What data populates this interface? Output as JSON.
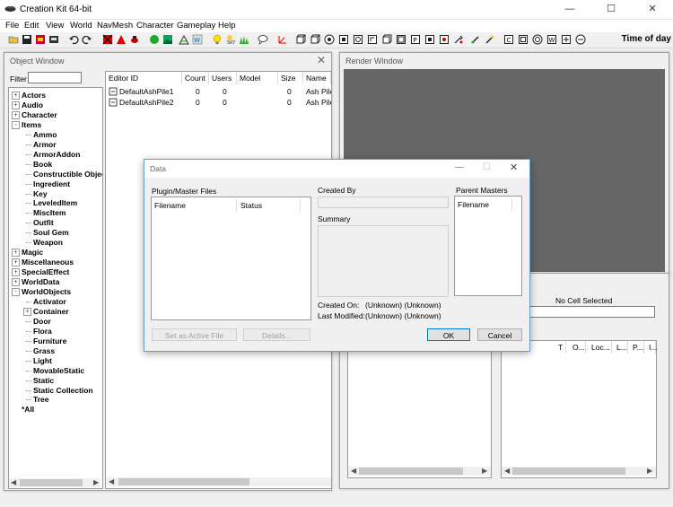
{
  "app": {
    "title": "Creation Kit 64-bit"
  },
  "menu": [
    "File",
    "Edit",
    "View",
    "World",
    "NavMesh",
    "Character",
    "Gameplay",
    "Help"
  ],
  "toolbar": {
    "time_of_day_label": "Time of day"
  },
  "object_window": {
    "title": "Object Window",
    "filter_label": "Filter",
    "filter_value": "",
    "tree": [
      {
        "label": "Actors",
        "level": 0,
        "expander": "+"
      },
      {
        "label": "Audio",
        "level": 0,
        "expander": "+"
      },
      {
        "label": "Character",
        "level": 0,
        "expander": "+"
      },
      {
        "label": "Items",
        "level": 0,
        "expander": "-"
      },
      {
        "label": "Ammo",
        "level": 1
      },
      {
        "label": "Armor",
        "level": 1
      },
      {
        "label": "ArmorAddon",
        "level": 1
      },
      {
        "label": "Book",
        "level": 1
      },
      {
        "label": "Constructible Objec",
        "level": 1
      },
      {
        "label": "Ingredient",
        "level": 1
      },
      {
        "label": "Key",
        "level": 1
      },
      {
        "label": "LeveledItem",
        "level": 1
      },
      {
        "label": "MiscItem",
        "level": 1
      },
      {
        "label": "Outfit",
        "level": 1
      },
      {
        "label": "Soul Gem",
        "level": 1
      },
      {
        "label": "Weapon",
        "level": 1
      },
      {
        "label": "Magic",
        "level": 0,
        "expander": "+"
      },
      {
        "label": "Miscellaneous",
        "level": 0,
        "expander": "+"
      },
      {
        "label": "SpecialEffect",
        "level": 0,
        "expander": "+"
      },
      {
        "label": "WorldData",
        "level": 0,
        "expander": "+"
      },
      {
        "label": "WorldObjects",
        "level": 0,
        "expander": "-"
      },
      {
        "label": "Activator",
        "level": 1
      },
      {
        "label": "Container",
        "level": 1,
        "expander": "+"
      },
      {
        "label": "Door",
        "level": 1
      },
      {
        "label": "Flora",
        "level": 1
      },
      {
        "label": "Furniture",
        "level": 1
      },
      {
        "label": "Grass",
        "level": 1
      },
      {
        "label": "Light",
        "level": 1
      },
      {
        "label": "MovableStatic",
        "level": 1
      },
      {
        "label": "Static",
        "level": 1
      },
      {
        "label": "Static Collection",
        "level": 1
      },
      {
        "label": "Tree",
        "level": 1
      },
      {
        "label": "*All",
        "level": 0
      }
    ],
    "columns": [
      "Editor ID",
      "Count",
      "Users",
      "Model",
      "Size",
      "Name"
    ],
    "rows": [
      {
        "editor_id": "DefaultAshPile1",
        "count": "0",
        "users": "0",
        "model": "",
        "size": "0",
        "name": "Ash Pile"
      },
      {
        "editor_id": "DefaultAshPile2",
        "count": "0",
        "users": "0",
        "model": "",
        "size": "0",
        "name": "Ash Pile"
      }
    ]
  },
  "render_window": {
    "title": "Render Window"
  },
  "cell_view": {
    "no_cell_label": "No Cell Selected",
    "right_columns": [
      "T",
      "O...",
      "Loc...",
      "L...",
      "P...",
      "I..."
    ]
  },
  "data_dialog": {
    "title": "Data",
    "plugin_section_label": "Plugin/Master Files",
    "plugin_columns": [
      "Filename",
      "Status"
    ],
    "created_by_label": "Created By",
    "created_by_value": "",
    "summary_label": "Summary",
    "created_on_label": "Created On:",
    "created_on_value": "(Unknown) (Unknown)",
    "last_modified_label": "Last Modified:",
    "last_modified_value": "(Unknown) (Unknown)",
    "parent_masters_label": "Parent Masters",
    "parent_masters_column": "Filename",
    "set_active_label": "Set as Active File",
    "details_label": "Details...",
    "ok_label": "OK",
    "cancel_label": "Cancel"
  }
}
